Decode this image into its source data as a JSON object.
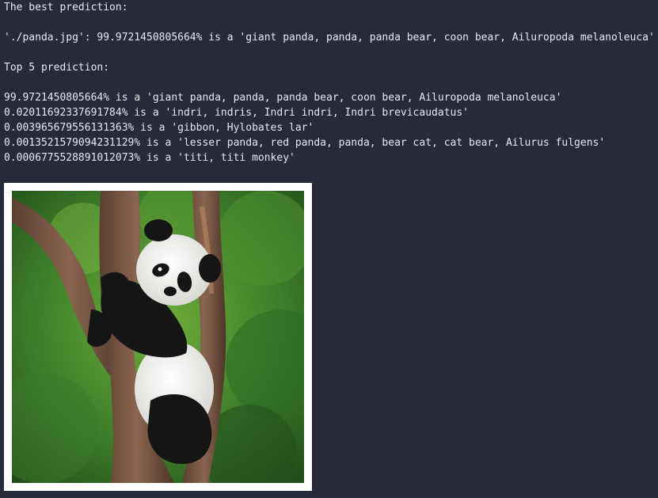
{
  "output": {
    "best_heading": "The best prediction:",
    "best_line": "'./panda.jpg': 99.9721450805664% is a 'giant panda, panda, panda bear, coon bear, Ailuropoda melanoleuca'",
    "top5_heading": "Top 5 prediction:",
    "top5": [
      "99.9721450805664% is a 'giant panda, panda, panda bear, coon bear, Ailuropoda melanoleuca'",
      "0.02011692337691784% is a 'indri, indris, Indri indri, Indri brevicaudatus'",
      "0.003965679556131363% is a 'gibbon, Hylobates lar'",
      "0.0013521579094231129% is a 'lesser panda, red panda, panda, bear cat, cat bear, Ailurus fulgens'",
      "0.0006775528891012073% is a 'titi, titi monkey'"
    ]
  },
  "colors": {
    "background": "#262a3b",
    "text": "#e8eaf0",
    "frame": "#ffffff"
  }
}
